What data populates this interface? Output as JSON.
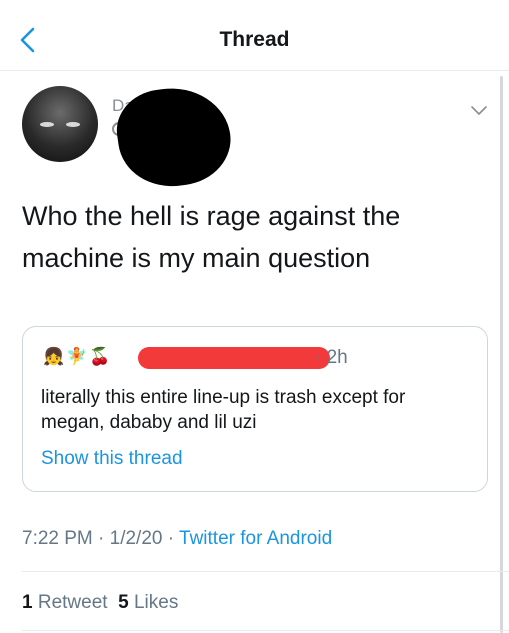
{
  "header": {
    "title": "Thread",
    "back_icon": "chevron-left-icon"
  },
  "tweet": {
    "author_name_partial": "Dar",
    "text": "Who the hell is rage against the machine is my main question",
    "menu_icon": "chevron-down-icon",
    "timestamp": "7:22 PM · 1/2/20 · ",
    "source": "Twitter for Android",
    "stats": {
      "retweets_count": "1",
      "retweets_label": "Retweet",
      "likes_count": "5",
      "likes_label": "Likes"
    }
  },
  "quoted": {
    "emojis": "👧🧚🍒",
    "time": "· 2h",
    "text": "literally this entire line-up is trash except for megan, dababy and lil uzi",
    "show_thread": "Show this thread"
  },
  "colors": {
    "link": "#1b95e0",
    "muted": "#657786",
    "text": "#14171a",
    "redaction": "#f23a3a"
  }
}
